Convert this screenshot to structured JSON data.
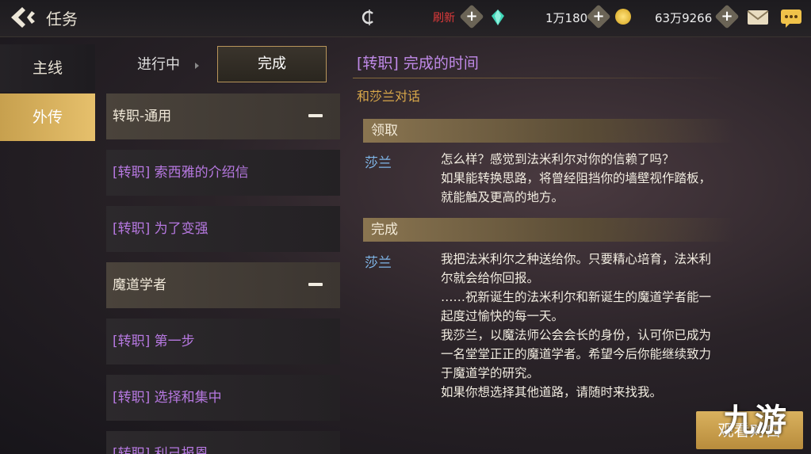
{
  "header": {
    "title": "任务",
    "refresh_label": "刷新",
    "gem_count": "1万180",
    "gold_count": "63万9266"
  },
  "sidebar": {
    "items": [
      {
        "label": "主线"
      },
      {
        "label": "外传"
      }
    ]
  },
  "subtabs": {
    "in_progress": "进行中",
    "completed": "完成"
  },
  "quest_list": [
    {
      "label": "转职-通用"
    },
    {
      "label": "[转职] 索西雅的介绍信"
    },
    {
      "label": "[转职] 为了变强"
    },
    {
      "label": "魔道学者"
    },
    {
      "label": "[转职] 第一步"
    },
    {
      "label": "[转职] 选择和集中"
    },
    {
      "label": "[转职] 利己报恩"
    }
  ],
  "detail": {
    "title": "[转职] 完成的时间",
    "talk_to": "和莎兰对话",
    "accept_label": "领取",
    "accept_speaker": "莎兰",
    "accept_lines": [
      "怎么样？感觉到法米利尔对你的信赖了吗？",
      "如果能转换思路，将曾经阻挡你的墙壁视作踏板，",
      "就能触及更高的地方。"
    ],
    "complete_label": "完成",
    "complete_speaker": "莎兰",
    "complete_lines": [
      "我把法米利尔之种送给你。只要精心培育，法米利",
      "尔就会给你回报。",
      "……祝新诞生的法米利尔和新诞生的魔道学者能一",
      "起度过愉快的每一天。",
      "我莎兰，以魔法师公会会长的身份，认可你已成为",
      "一名堂堂正正的魔道学者。希望今后你能继续致力",
      "于魔道学的研究。",
      "如果你想选择其他道路，请随时来找我。"
    ],
    "watch_button": "观看对白"
  },
  "watermark": "九游"
}
